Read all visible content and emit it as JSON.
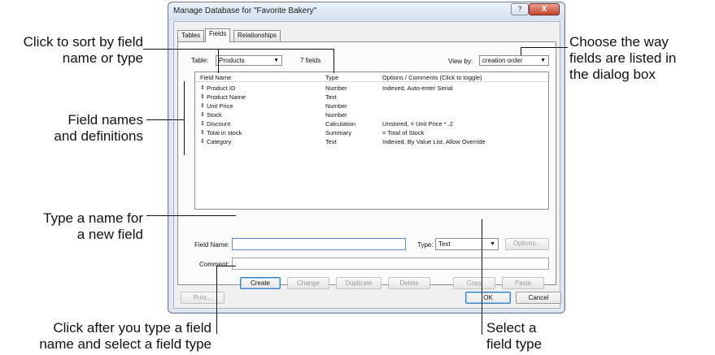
{
  "callouts": {
    "sort": "Click to sort by field name or type",
    "sort_line1": "Click to sort by field",
    "sort_line2": "name or type",
    "names_line1": "Field names",
    "names_line2": "and definitions",
    "type_name_line1": "Type a name for",
    "type_name_line2": "a new field",
    "click_after_line1": "Click after you type a field",
    "click_after_line2": "name and select a field type",
    "view_line1": "Choose the way",
    "view_line2": "fields are listed in",
    "view_line3": "the dialog box",
    "select_line1": "Select a",
    "select_line2": "field type"
  },
  "dialog": {
    "title": "Manage Database for \"Favorite Bakery\"",
    "help_glyph": "?",
    "close_glyph": "X",
    "tabs": [
      "Tables",
      "Fields",
      "Relationships"
    ],
    "table_label": "Table:",
    "table_value": "Products",
    "field_count": "7 fields",
    "view_by_label": "View by:",
    "view_by_value": "creation order",
    "columns": {
      "name": "Field Name",
      "type": "Type",
      "options": "Options / Comments  (Click to toggle)"
    },
    "fields": [
      {
        "name": "Product ID",
        "type": "Number",
        "options": "Indexed, Auto-enter Serial"
      },
      {
        "name": "Product Name",
        "type": "Text",
        "options": ""
      },
      {
        "name": "Unit Price",
        "type": "Number",
        "options": ""
      },
      {
        "name": "Stock",
        "type": "Number",
        "options": ""
      },
      {
        "name": "Discount",
        "type": "Calculation",
        "options": "Unstored, = Unit Price * .2"
      },
      {
        "name": "Total in stock",
        "type": "Summary",
        "options": "= Total of Stock"
      },
      {
        "name": "Category",
        "type": "Text",
        "options": "Indexed, By Value List, Allow Override"
      }
    ],
    "field_name_label": "Field Name:",
    "field_name_value": "",
    "type_label": "Type:",
    "type_value": "Text",
    "options_button": "Options...",
    "comment_label": "Comment:",
    "comment_value": "",
    "buttons": {
      "create": "Create",
      "change": "Change",
      "duplicate": "Duplicate",
      "delete": "Delete",
      "copy": "Copy",
      "paste": "Paste",
      "print": "Print...",
      "ok": "OK",
      "cancel": "Cancel"
    }
  },
  "icons": {
    "help": "help-icon",
    "close": "close-icon",
    "handle": "reorder-handle-icon",
    "arrow": "chevron-down-icon"
  },
  "colors": {
    "close_button": "#c6462f",
    "focus_border": "#5b8fd4",
    "ok_button_border": "#3f7fc5"
  }
}
